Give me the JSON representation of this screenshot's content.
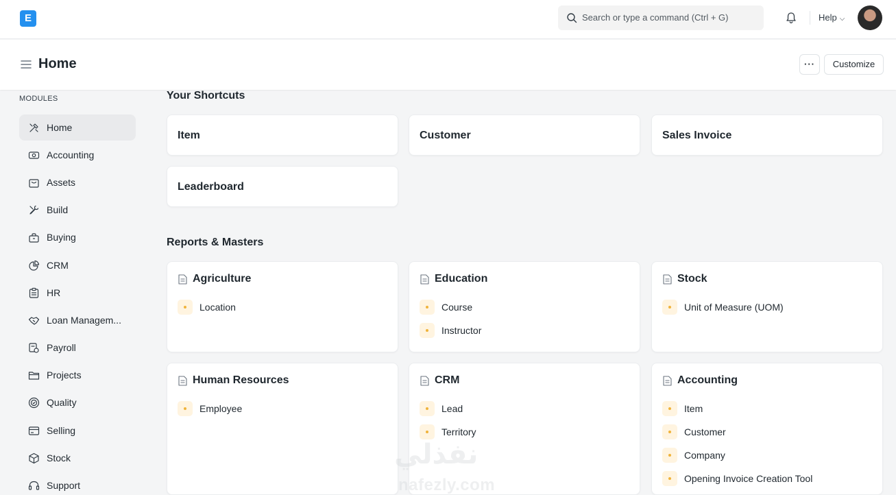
{
  "navbar": {
    "logo_letter": "E",
    "search_placeholder": "Search or type a command (Ctrl + G)",
    "help_label": "Help"
  },
  "page": {
    "title": "Home",
    "more_label": "···",
    "customize_label": "Customize"
  },
  "sidebar": {
    "section_label": "MODULES",
    "items": [
      {
        "label": "Home",
        "icon": "tools-icon"
      },
      {
        "label": "Accounting",
        "icon": "money-icon"
      },
      {
        "label": "Assets",
        "icon": "bag-icon"
      },
      {
        "label": "Build",
        "icon": "wrench-icon"
      },
      {
        "label": "Buying",
        "icon": "shopping-bag-icon"
      },
      {
        "label": "CRM",
        "icon": "pie-icon"
      },
      {
        "label": "HR",
        "icon": "clipboard-icon"
      },
      {
        "label": "Loan Managem...",
        "icon": "handshake-icon"
      },
      {
        "label": "Payroll",
        "icon": "receipt-icon"
      },
      {
        "label": "Projects",
        "icon": "folder-icon"
      },
      {
        "label": "Quality",
        "icon": "shield-icon"
      },
      {
        "label": "Selling",
        "icon": "card-icon"
      },
      {
        "label": "Stock",
        "icon": "box-icon"
      },
      {
        "label": "Support",
        "icon": "headset-icon"
      }
    ]
  },
  "shortcuts": {
    "title": "Your Shortcuts",
    "items": [
      "Item",
      "Customer",
      "Sales Invoice",
      "Leaderboard"
    ]
  },
  "reports": {
    "title": "Reports & Masters",
    "cards": [
      {
        "title": "Agriculture",
        "links": [
          "Location"
        ]
      },
      {
        "title": "Education",
        "links": [
          "Course",
          "Instructor"
        ]
      },
      {
        "title": "Stock",
        "links": [
          "Unit of Measure (UOM)"
        ]
      },
      {
        "title": "Human Resources",
        "links": [
          "Employee"
        ]
      },
      {
        "title": "CRM",
        "links": [
          "Lead",
          "Territory"
        ]
      },
      {
        "title": "Accounting",
        "links": [
          "Item",
          "Customer",
          "Company",
          "Opening Invoice Creation Tool"
        ]
      }
    ]
  },
  "watermark": {
    "arabic": "نفذلي",
    "latin": "nafezly.com"
  },
  "colors": {
    "brand": "#2490ef",
    "link_dot": "#f0b33b",
    "link_dot_bg": "#fff4e0"
  }
}
